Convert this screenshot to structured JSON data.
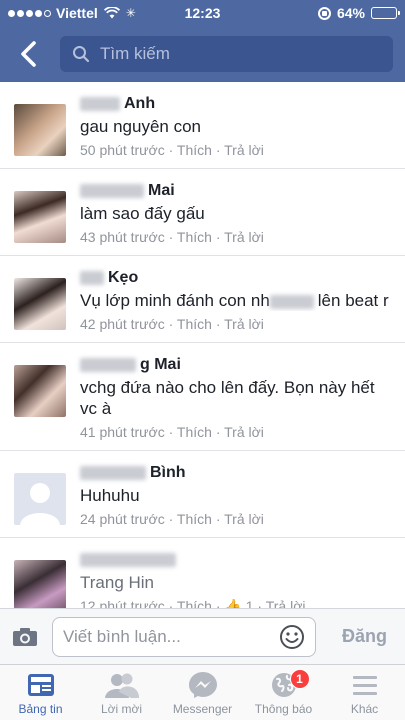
{
  "status_bar": {
    "carrier": "Viettel",
    "time": "12:23",
    "battery": "64%",
    "battery_level": 0.64,
    "signal_bars_filled": 4,
    "signal_bars_total": 5
  },
  "header": {
    "search_placeholder": "Tìm kiếm"
  },
  "comments": [
    {
      "name": "Anh",
      "text": "gau nguyên con",
      "time": "50 phút trước",
      "like": "Thích",
      "reply": "Trả lời"
    },
    {
      "name": "Mai",
      "text": "làm sao đấy gấu",
      "time": "43 phút trước",
      "like": "Thích",
      "reply": "Trả lời"
    },
    {
      "name": "Kẹo",
      "text": "Vụ lớp minh đánh con nh",
      "text_after": "lên beat r",
      "time": "42 phút trước",
      "like": "Thích",
      "reply": "Trả lời"
    },
    {
      "name": "g Mai",
      "text": "vchg đứa nào cho lên đấy. Bọn này hết vc à",
      "time": "41 phút trước",
      "like": "Thích",
      "reply": "Trả lời"
    },
    {
      "name": "Bình",
      "text": "Huhuhu",
      "time": "24 phút trước",
      "like": "Thích",
      "reply": "Trả lời"
    },
    {
      "name": "Trang Hin",
      "time": "12 phút trước",
      "like": "Thích",
      "likes_count": "1",
      "reply": "Trả lời"
    }
  ],
  "composer": {
    "placeholder": "Viết bình luận...",
    "post_label": "Đăng"
  },
  "tabbar": {
    "tabs": [
      {
        "label": "Bảng tin",
        "icon": "news-feed-icon",
        "active": true
      },
      {
        "label": "Lời mời",
        "icon": "friend-requests-icon"
      },
      {
        "label": "Messenger",
        "icon": "messenger-icon"
      },
      {
        "label": "Thông báo",
        "icon": "globe-icon",
        "badge": "1"
      },
      {
        "label": "Khác",
        "icon": "menu-icon"
      }
    ]
  },
  "colors": {
    "header": "#4e69a2",
    "search_field": "#3b5590",
    "accent": "#4267b2",
    "badge": "#fa3e3e",
    "meta_text": "#90949c"
  }
}
